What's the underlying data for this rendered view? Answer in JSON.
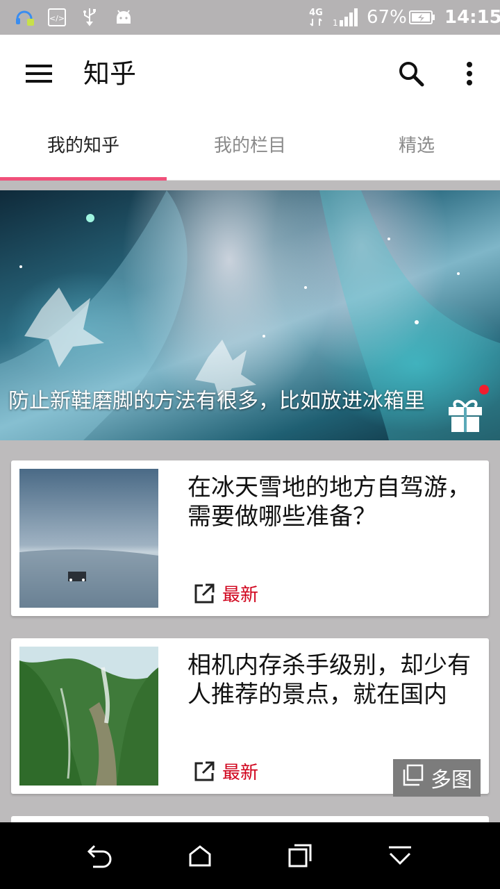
{
  "status_bar": {
    "network": "4G",
    "battery_percent": "67%",
    "time": "14:15",
    "icons": [
      "headset-icon",
      "code-icon",
      "usb-icon",
      "android-icon",
      "signal-icon",
      "battery-charging-icon"
    ]
  },
  "toolbar": {
    "title": "知乎",
    "icons": [
      "menu-icon",
      "search-icon",
      "more-vert-icon"
    ]
  },
  "tabs": [
    {
      "label": "我的知乎",
      "active": true
    },
    {
      "label": "我的栏目",
      "active": false
    },
    {
      "label": "精选",
      "active": false
    }
  ],
  "accent_color": "#f0507a",
  "hero": {
    "caption": "防止新鞋磨脚的方法有很多，比如放进冰箱里",
    "badge_icon": "gift-icon",
    "badge_dot_color": "#f21e2e"
  },
  "feed": [
    {
      "title": "在冰天雪地的地方自驾游，需要做哪些准备？",
      "tag": "最新",
      "tag_color": "#d0021b",
      "image": "snowy-road-truck"
    },
    {
      "title": "相机内存杀手级别，却少有人推荐的景点，就在国内",
      "tag": "最新",
      "tag_color": "#d0021b",
      "image": "green-canyon-waterfall",
      "multi_label": "多图"
    }
  ],
  "nav_bar": {
    "icons": [
      "back-icon",
      "home-icon",
      "recents-icon",
      "hide-nav-icon"
    ]
  }
}
